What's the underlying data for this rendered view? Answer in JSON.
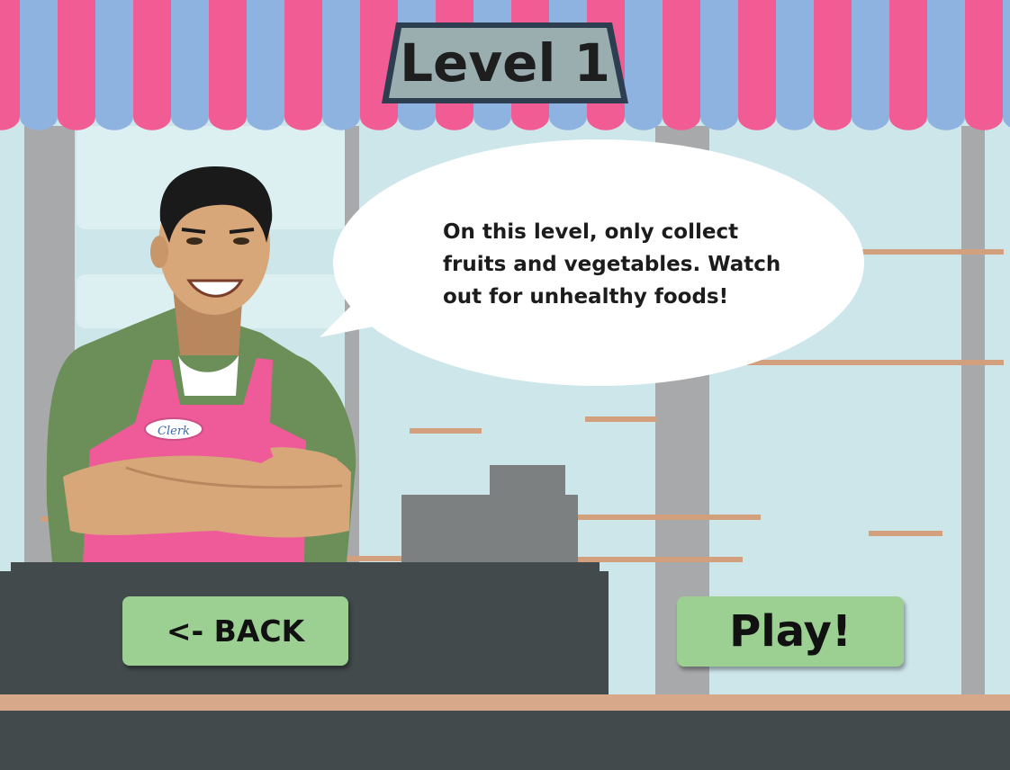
{
  "title": "Level 1",
  "speech": {
    "lines": [
      "On this level, only collect",
      "fruits and vegetables. Watch",
      "out for unhealthy foods!"
    ]
  },
  "name_badge": "Clerk",
  "buttons": {
    "back_label": "<- BACK",
    "play_label": "Play!"
  },
  "colors": {
    "awning_pink": "#f25c94",
    "awning_blue": "#8fb3e0",
    "wall": "#cde6ea",
    "pillar": "#a8a9ab",
    "counter": "#424a4b",
    "button": "#9ccf92",
    "apron": "#ee5b98",
    "shirt": "#6c8f5a",
    "skin": "#d7a779",
    "register": "#7d8081",
    "shelf": "#d2a07d"
  }
}
